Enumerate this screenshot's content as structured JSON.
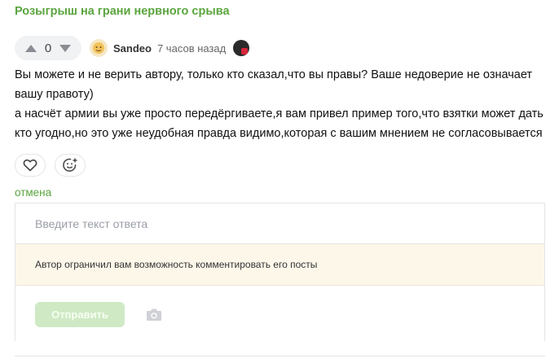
{
  "post": {
    "title": "Розыгрыш на грани нервного срыва"
  },
  "comment": {
    "rating": "0",
    "author": "Sandeo",
    "time": "7 часов назад",
    "paragraphs": [
      "Вы можете и не верить автору, только кто сказал,что вы правы? Ваше недоверие не означает вашу правоту)",
      "а насчёт армии вы уже просто передёргиваете,я вам привел пример того,что взятки может дать кто угодно,но это уже неудобная правда видимо,которая с вашим мнением не согласовывается"
    ]
  },
  "actions": {
    "cancel_label": "отмена"
  },
  "reply": {
    "placeholder": "Введите текст ответа",
    "restriction_notice": "Автор ограничил вам возможность комментировать его посты",
    "send_label": "Отправить"
  },
  "icons": {
    "upvote": "arrow-up-icon",
    "downvote": "arrow-down-icon",
    "like": "heart-icon",
    "emoji": "smiley-add-icon",
    "attach": "camera-icon"
  },
  "colors": {
    "accent": "#5aa53e",
    "send_disabled": "#cfe9c5",
    "notice_bg": "#fcf7e9"
  }
}
